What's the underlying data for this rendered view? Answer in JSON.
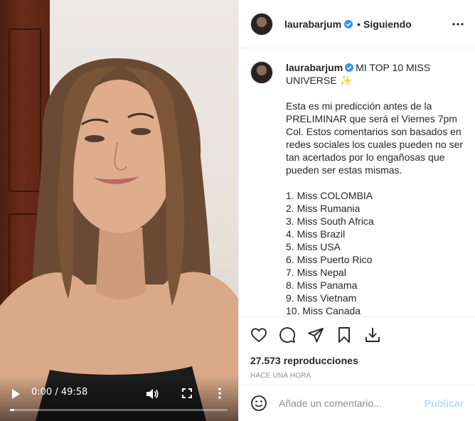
{
  "video": {
    "timecode": "0:00 / 49:58",
    "progress": 0.02,
    "controls": [
      "play-icon",
      "volume-icon",
      "fullscreen-icon",
      "more-icon"
    ]
  },
  "post": {
    "username": "laurabarjum",
    "follow_sep": "•",
    "follow_status": "Siguiendo",
    "caption_title": "MI TOP 10 MISS UNIVERSE ✨",
    "caption_paragraph": "Esta es mi predicción antes de la PRELIMINAR que será el Viernes 7pm Col. Estos comentarios son basados en redes sociales los cuales pueden no ser tan acertados por lo engañosas que pueden ser estas mismas.",
    "ranking": [
      "1. Miss COLOMBIA",
      "2. Miss Rumania",
      "3. Miss South Africa",
      "4. Miss Brazil",
      "5. Miss USA",
      "6. Miss Puerto Rico",
      "7. Miss Nepal",
      "8. Miss Panama",
      "9. Miss Vietnam",
      "10. Miss Canada"
    ],
    "views": "27.573 reproducciones",
    "time_ago": "HACE UNA HORA",
    "comment_placeholder": "Añade un comentario...",
    "publish_label": "Publicar"
  },
  "colors": {
    "verified": "#3897f0",
    "publish_disabled": "#b2dffc",
    "secondary_text": "#8e8e8e"
  },
  "icons": [
    "verified-badge-icon",
    "more-options-icon",
    "heart-icon",
    "comment-icon",
    "share-icon",
    "bookmark-icon",
    "download-icon",
    "emoji-icon"
  ]
}
